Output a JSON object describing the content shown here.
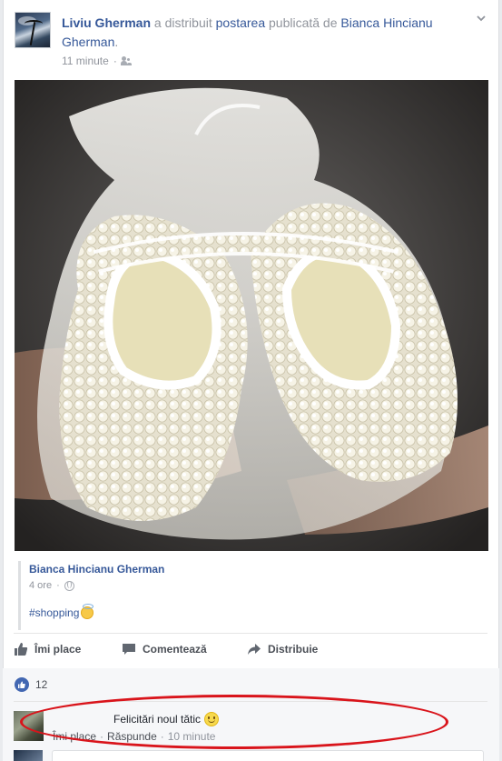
{
  "post": {
    "author": "Liviu Gherman",
    "action_text": " a distribuit ",
    "post_link": "postarea",
    "published_by": " publicată de ",
    "original_author": "Bianca Hincianu Gherman",
    "period": ".",
    "time": "11 minute",
    "audience_icon": "friends-icon",
    "menu_icon": "chevron-down-icon"
  },
  "shared": {
    "author": "Bianca Hincianu Gherman",
    "time": "4 ore",
    "audience_icon": "globe-icon",
    "hashtag": "#shopping",
    "emoji": "angel-emoji"
  },
  "actions": {
    "like": "Îmi place",
    "comment": "Comentează",
    "share": "Distribuie"
  },
  "reactions": {
    "count": "12"
  },
  "comment": {
    "text": "Felicitări noul tătic",
    "emoji": "smile-emoji",
    "like": "Îmi place",
    "separator": "·",
    "reply": "Răspunde",
    "time": "10 minute"
  },
  "colors": {
    "link": "#365899",
    "meta": "#90949c",
    "highlight": "#d9141b",
    "like_blue": "#4267b2"
  }
}
